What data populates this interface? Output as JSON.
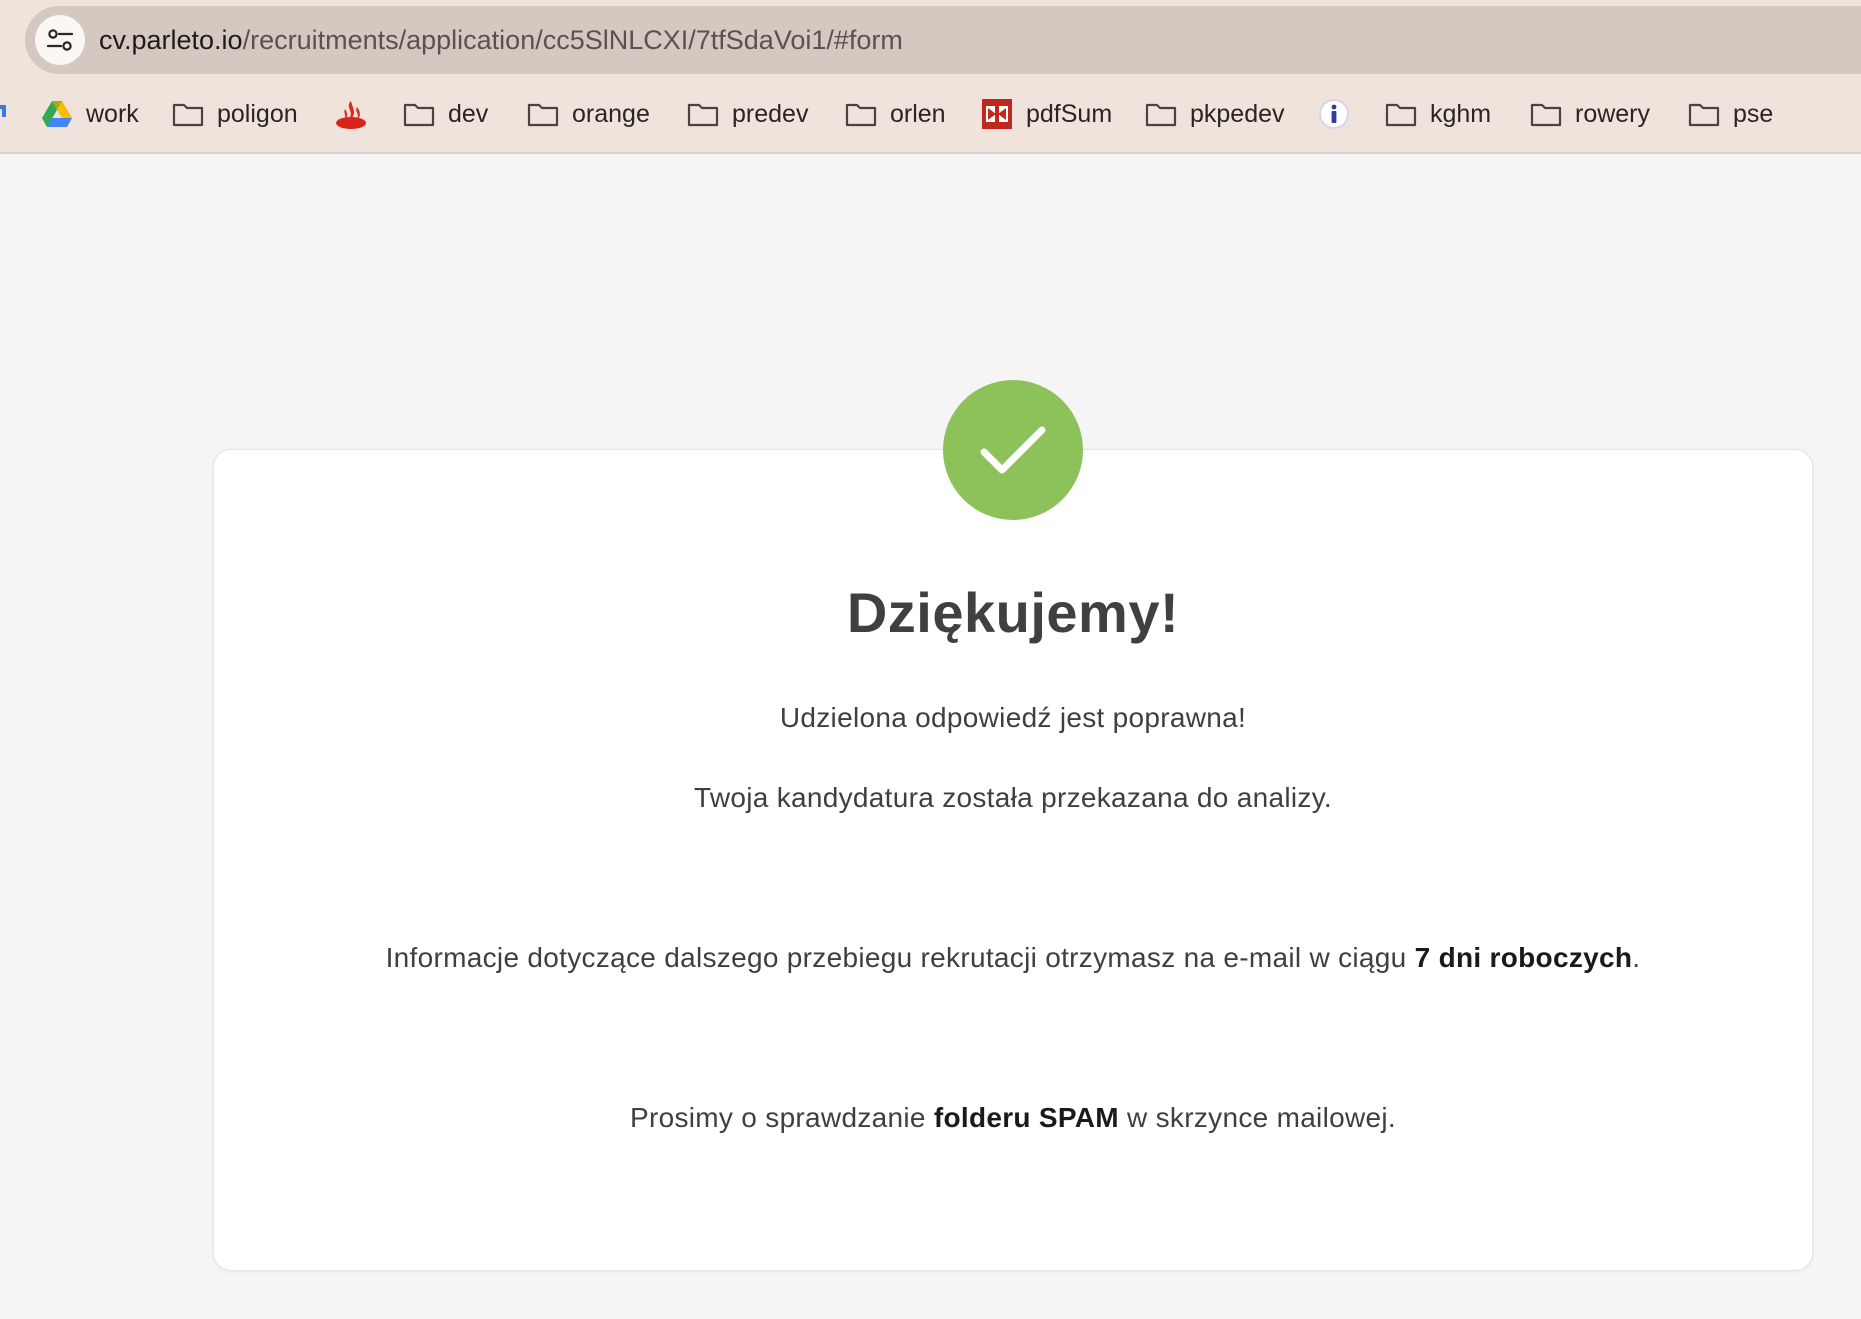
{
  "browser": {
    "url_host": "cv.parleto.io",
    "url_path": "/recruitments/application/cc5SlNLCXI/7tfSdaVoi1/#form",
    "bookmarks": [
      {
        "label": "work",
        "icon": "google-drive-icon"
      },
      {
        "label": "poligon",
        "icon": "folder-icon"
      },
      {
        "label": "",
        "icon": "santander-flame-icon"
      },
      {
        "label": "dev",
        "icon": "folder-icon"
      },
      {
        "label": "orange",
        "icon": "folder-icon"
      },
      {
        "label": "predev",
        "icon": "folder-icon"
      },
      {
        "label": "orlen",
        "icon": "folder-icon"
      },
      {
        "label": "pdfSum",
        "icon": "pdf-tool-icon"
      },
      {
        "label": "pkpedev",
        "icon": "folder-icon"
      },
      {
        "label": "",
        "icon": "info-circle-icon"
      },
      {
        "label": "kghm",
        "icon": "folder-icon"
      },
      {
        "label": "rowery",
        "icon": "folder-icon"
      },
      {
        "label": "pse",
        "icon": "folder-icon"
      }
    ]
  },
  "confirmation": {
    "title": "Dziękujemy!",
    "line1": "Udzielona odpowiedź jest poprawna!",
    "line2": "Twoja kandydatura została przekazana do analizy.",
    "line3_prefix": "Informacje dotyczące dalszego przebiegu rekrutacji otrzymasz na e-mail w ciągu ",
    "line3_bold": "7 dni roboczych",
    "line3_suffix": ".",
    "line4_prefix": "Prosimy o sprawdzanie ",
    "line4_bold": "folderu SPAM",
    "line4_suffix": " w skrzynce mailowej."
  },
  "colors": {
    "success_green": "#8dc15a",
    "chrome_bg": "#efe3dc",
    "address_bar_bg": "#d4c8c1",
    "page_bg": "#f5f5f5"
  }
}
